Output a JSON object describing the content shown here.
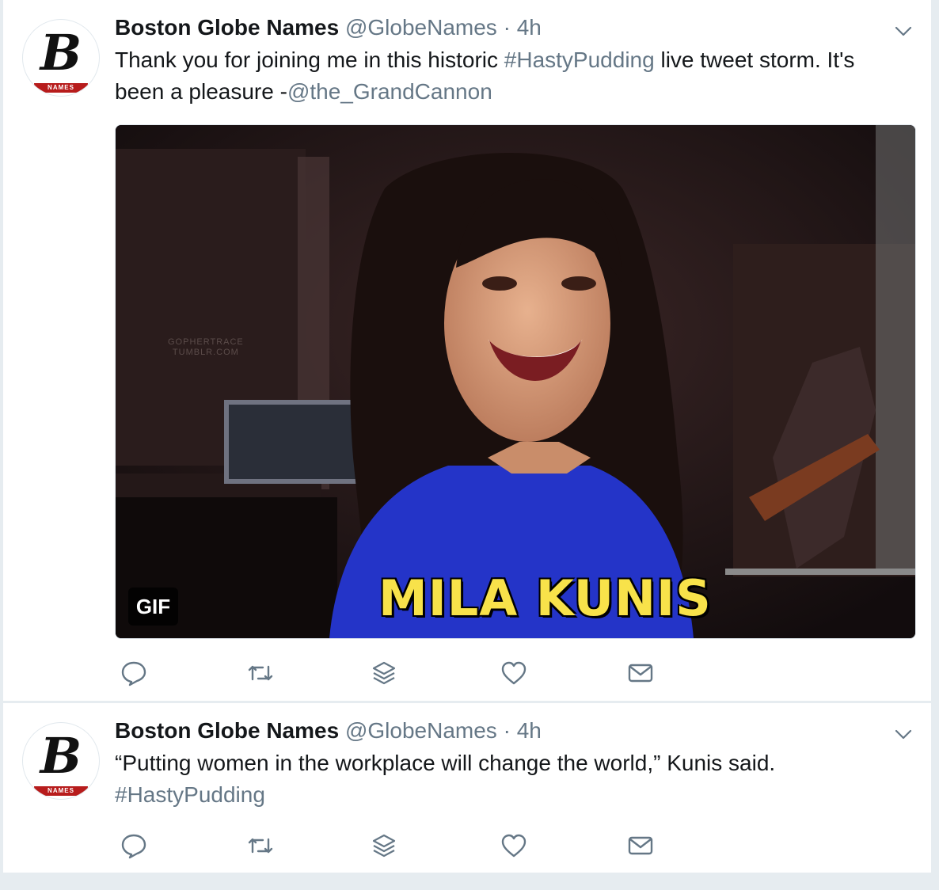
{
  "tweets": [
    {
      "name": "Boston Globe Names",
      "handle": "@GlobeNames",
      "dot": "·",
      "time": "4h",
      "text_before": "Thank you for joining me in this historic ",
      "hashtag": "#HastyPudding",
      "text_middle": " live tweet storm. It's been a pleasure -",
      "mention": "@the_GrandCannon",
      "avatar_badge": "NAMES",
      "media": {
        "caption": "MILA KUNIS",
        "badge": "GIF",
        "watermark_line1": "GOPHERTRACE",
        "watermark_line2": "TUMBLR.COM"
      }
    },
    {
      "name": "Boston Globe Names",
      "handle": "@GlobeNames",
      "dot": "·",
      "time": "4h",
      "text": "“Putting women in the workplace will change the world,” Kunis said.",
      "hashtag": "#HastyPudding",
      "avatar_badge": "NAMES"
    }
  ],
  "icons": [
    "reply-icon",
    "retweet-icon",
    "stack-icon",
    "like-icon",
    "message-icon",
    "chevron-down-icon"
  ],
  "colors": {
    "secondary_text": "#657786",
    "caption_yellow": "#f8e24a",
    "shirt_blue": "#2434c8"
  }
}
